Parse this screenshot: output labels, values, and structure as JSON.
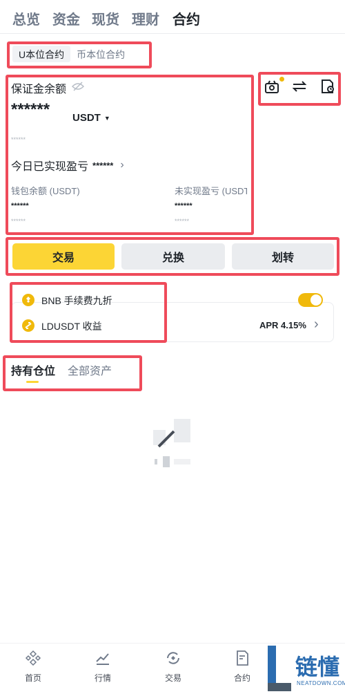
{
  "top_nav": [
    "总览",
    "资金",
    "现货",
    "理财",
    "合约"
  ],
  "segment": {
    "usdt_margined": "U本位合约",
    "coin_margined": "币本位合约"
  },
  "balance": {
    "margin_label": "保证金余额",
    "amount_masked": "******",
    "currency": "USDT",
    "sub_masked": "******",
    "today_pnl_label": "今日已实现盈亏",
    "today_pnl_masked": "******",
    "wallet_label": "钱包余额 (USDT)",
    "wallet_masked": "******",
    "wallet_sub": "******",
    "unrealized_label": "未实现盈亏 (USDT",
    "unrealized_masked": "******",
    "unrealized_sub": "******"
  },
  "actions": {
    "trade": "交易",
    "convert": "兑换",
    "transfer": "划转"
  },
  "features": {
    "bnb_label": "BNB 手续费九折",
    "bnb_toggle_on": true,
    "ldusdt_label": "LDUSDT 收益",
    "apr": "APR 4.15%"
  },
  "positions_tabs": {
    "holding": "持有仓位",
    "all_assets": "全部资产"
  },
  "bottom_tabs": [
    "首页",
    "行情",
    "交易",
    "合约"
  ],
  "watermark": {
    "brand": "链懂",
    "url": "NEATDOWN.COM"
  },
  "colors": {
    "accent": "#fcd535",
    "highlight": "#ef4b5a",
    "toggle": "#f0b90b"
  }
}
